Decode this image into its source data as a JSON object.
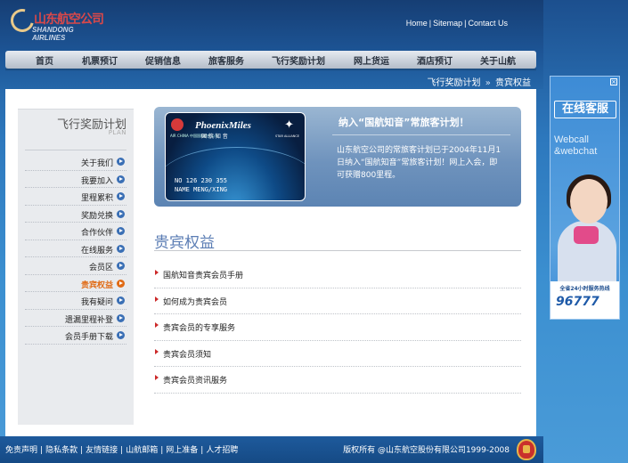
{
  "header": {
    "logo_cn": "山东航空公司",
    "logo_en": "SHANDONG AIRLINES",
    "toplinks": [
      "Home",
      "Sitemap",
      "Contact Us"
    ]
  },
  "nav": {
    "items": [
      "首页",
      "机票预订",
      "促销信息",
      "旅客服务",
      "飞行奖励计划",
      "网上货运",
      "酒店预订",
      "关于山航"
    ]
  },
  "breadcrumb": {
    "section": "飞行奖励计划",
    "arrow": "»",
    "current": "贵宾权益"
  },
  "sidebar": {
    "title": "飞行奖励计划",
    "subtitle": "PLAN",
    "items": [
      "关于我们",
      "我要加入",
      "里程累积",
      "奖励兑换",
      "合作伙伴",
      "在线服务",
      "会员区",
      "贵宾权益",
      "我有疑问",
      "遗漏里程补登",
      "会员手册下载"
    ],
    "active": "贵宾权益"
  },
  "banner": {
    "card": {
      "airline_small": "AIR CHINA 中国国际航空公司",
      "brand": "PhoenixMiles",
      "brand_cn": "国 航 知 音",
      "alliance": "STAR ALLIANCE",
      "number": "NO  126 230 355",
      "name": "NAME MENG/XING"
    },
    "title": "纳入“国航知音”常旅客计划！",
    "text": "山东航空公司的常旅客计划已于2004年11月1日纳入“国航知音”常旅客计划！网上入会，即可获赠800里程。"
  },
  "section": {
    "title": "贵宾权益",
    "links": [
      "国航知音贵宾会员手册",
      "如何成为贵宾会员",
      "贵宾会员的专享服务",
      "贵宾会员须知",
      "贵宾会员资讯服务"
    ]
  },
  "footer": {
    "links": [
      "免责声明",
      "隐私条款",
      "友情链接",
      "山航邮箱",
      "网上准备",
      "人才招聘"
    ],
    "copyright": "版权所有 @山东航空股份有限公司1999-2008"
  },
  "ad": {
    "close": "×",
    "title": "在线客服",
    "en": "Webcall &webchat",
    "hotline": "全省24小时服务热线",
    "number": "96777"
  },
  "colors": {
    "accent": "#e06a14",
    "link_blue": "#3a6fb5",
    "bullet_red": "#cc2a2a",
    "header_blue": "#1d5596"
  }
}
